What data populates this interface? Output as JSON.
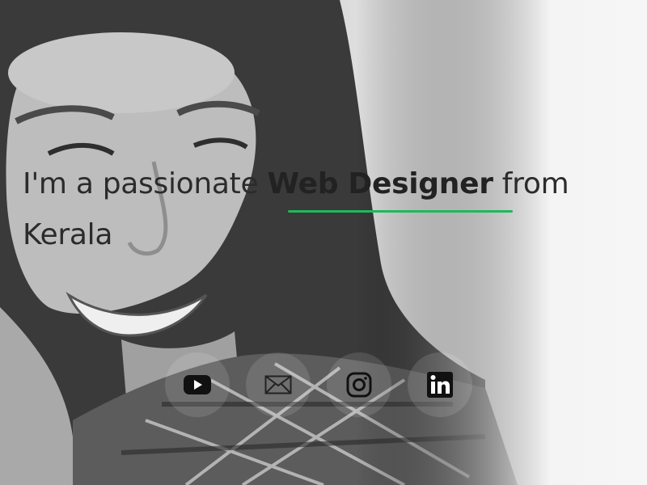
{
  "hero": {
    "headline_prefix": "I'm a passionate ",
    "headline_accent": "Web Designer",
    "headline_suffix": " from Kerala",
    "accent_underline_color": "#1fb85c"
  },
  "social_links": [
    {
      "name": "youtube",
      "icon": "youtube-icon"
    },
    {
      "name": "email",
      "icon": "mail-icon"
    },
    {
      "name": "instagram",
      "icon": "instagram-icon"
    },
    {
      "name": "linkedin",
      "icon": "linkedin-icon"
    }
  ]
}
